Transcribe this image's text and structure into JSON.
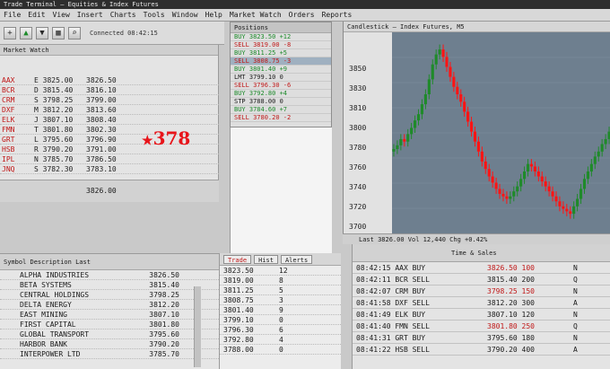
{
  "window": {
    "title": "Trade Terminal — Equities & Index Futures",
    "menu": [
      "File",
      "Edit",
      "View",
      "Insert",
      "Charts",
      "Tools",
      "Window",
      "Help",
      "Market Watch",
      "Orders",
      "Reports"
    ]
  },
  "toolbar": {
    "buttons": [
      {
        "icon": "new-order-icon",
        "glyph": "+"
      },
      {
        "icon": "arrow-up-icon",
        "glyph": "▲"
      },
      {
        "icon": "arrow-down-icon",
        "glyph": "▼"
      },
      {
        "icon": "grid-icon",
        "glyph": "▦"
      },
      {
        "icon": "zoom-icon",
        "glyph": "⌕"
      }
    ],
    "status_label": "Connected  08:42:15"
  },
  "quote_panel": {
    "title": "Market Watch",
    "rows": [
      {
        "sym": "AAX",
        "bid": "E 3825.00",
        "ask": "3826.50"
      },
      {
        "sym": "BCR",
        "bid": "D 3815.40",
        "ask": "3816.10"
      },
      {
        "sym": "CRM",
        "bid": "S 3798.25",
        "ask": "3799.00"
      },
      {
        "sym": "DXF",
        "bid": "M 3812.20",
        "ask": "3813.60"
      },
      {
        "sym": "ELK",
        "bid": "J 3807.10",
        "ask": "3808.40"
      },
      {
        "sym": "FMN",
        "bid": "T 3801.80",
        "ask": "3802.30"
      },
      {
        "sym": "GRT",
        "bid": "L 3795.60",
        "ask": "3796.90"
      },
      {
        "sym": "HSB",
        "bid": "R 3790.20",
        "ask": "3791.00"
      },
      {
        "sym": "IPL",
        "bid": "N 3785.70",
        "ask": "3786.50"
      },
      {
        "sym": "JNQ",
        "bid": "S 3782.30",
        "ask": "3783.10"
      }
    ],
    "last_price": "378",
    "footer": "3826.00"
  },
  "order_panel": {
    "title": "Positions",
    "rows": [
      {
        "text": "BUY  3823.50  +12",
        "tone": "g"
      },
      {
        "text": "SELL 3819.00  -8",
        "tone": "r"
      },
      {
        "text": "BUY  3811.25  +5",
        "tone": "g"
      },
      {
        "text": "SELL 3808.75  -3",
        "tone": "r"
      },
      {
        "text": "BUY  3801.40  +9",
        "tone": "g"
      },
      {
        "text": "LMT  3799.10   0",
        "tone": ""
      },
      {
        "text": "SELL 3796.30  -6",
        "tone": "r"
      },
      {
        "text": "BUY  3792.80  +4",
        "tone": "g"
      },
      {
        "text": "STP  3788.00   0",
        "tone": ""
      },
      {
        "text": "BUY  3784.60  +7",
        "tone": "g"
      },
      {
        "text": "SELL 3780.20  -2",
        "tone": "r"
      }
    ]
  },
  "chart": {
    "title": "Candlestick — Index Futures, M5",
    "labels": [
      "3850",
      "3830",
      "3810",
      "3800",
      "3780",
      "3760",
      "3740",
      "3720",
      "3700"
    ],
    "status": "Last 3826.00   Vol 12,440   Chg +0.42%"
  },
  "chart_data": {
    "type": "candlestick",
    "title": "Candlestick — Index Futures, M5",
    "xlabel": "",
    "ylabel": "",
    "ylim": [
      3700,
      3850
    ],
    "grid": true,
    "series": [
      {
        "name": "",
        "values": [
          3762,
          3765,
          3770,
          3768,
          3774,
          3779,
          3785,
          3790,
          3798,
          3806,
          3818,
          3830,
          3838,
          3842,
          3836,
          3828,
          3820,
          3812,
          3806,
          3800,
          3792,
          3784,
          3776,
          3768,
          3760,
          3752,
          3746,
          3740,
          3735,
          3730,
          3726,
          3724,
          3722,
          3724,
          3728,
          3732,
          3738,
          3744,
          3750,
          3748,
          3744,
          3740,
          3736,
          3732,
          3728,
          3724,
          3720,
          3716,
          3714,
          3712,
          3710,
          3716,
          3722,
          3730,
          3738,
          3744,
          3750,
          3756,
          3760,
          3766,
          3770,
          3776
        ]
      }
    ],
    "colors": {
      "down": "#ff1414",
      "up": "#1f8a2a",
      "background": "#6e7f8f"
    }
  },
  "table_left": {
    "header": "Symbol    Description    Last",
    "rows": [
      {
        "name": "ALPHA INDUSTRIES",
        "val": "3826.50"
      },
      {
        "name": "BETA SYSTEMS",
        "val": "3815.40"
      },
      {
        "name": "CENTRAL HOLDINGS",
        "val": "3798.25"
      },
      {
        "name": "DELTA ENERGY",
        "val": "3812.20"
      },
      {
        "name": "EAST MINING",
        "val": "3807.10"
      },
      {
        "name": "FIRST CAPITAL",
        "val": "3801.80"
      },
      {
        "name": "GLOBAL TRANSPORT",
        "val": "3795.60"
      },
      {
        "name": "HARBOR BANK",
        "val": "3790.20"
      },
      {
        "name": "INTERPOWER LTD",
        "val": "3785.70"
      }
    ]
  },
  "table_mid": {
    "tabs": [
      "Trade",
      "Hist",
      "Alerts"
    ],
    "rows": [
      {
        "a": "3823.50",
        "b": "12"
      },
      {
        "a": "3819.00",
        "b": "8"
      },
      {
        "a": "3811.25",
        "b": "5"
      },
      {
        "a": "3808.75",
        "b": "3"
      },
      {
        "a": "3801.40",
        "b": "9"
      },
      {
        "a": "3799.10",
        "b": "0"
      },
      {
        "a": "3796.30",
        "b": "6"
      },
      {
        "a": "3792.80",
        "b": "4"
      },
      {
        "a": "3788.00",
        "b": "0"
      }
    ]
  },
  "table_right": {
    "header": "Time & Sales",
    "rows": [
      {
        "k": "08:42:15  AAX  BUY",
        "v": "3826.50  100",
        "e": "N",
        "red": true
      },
      {
        "k": "08:42:11  BCR  SELL",
        "v": "3815.40  200",
        "e": "Q",
        "red": false
      },
      {
        "k": "08:42:07  CRM  BUY",
        "v": "3798.25  150",
        "e": "N",
        "red": true
      },
      {
        "k": "08:41:58  DXF  SELL",
        "v": "3812.20  300",
        "e": "A",
        "red": false
      },
      {
        "k": "08:41:49  ELK  BUY",
        "v": "3807.10  120",
        "e": "N",
        "red": false
      },
      {
        "k": "08:41:40  FMN  SELL",
        "v": "3801.80  250",
        "e": "Q",
        "red": true
      },
      {
        "k": "08:41:31  GRT  BUY",
        "v": "3795.60  180",
        "e": "N",
        "red": false
      },
      {
        "k": "08:41:22  HSB  SELL",
        "v": "3790.20  400",
        "e": "A",
        "red": false
      }
    ]
  }
}
